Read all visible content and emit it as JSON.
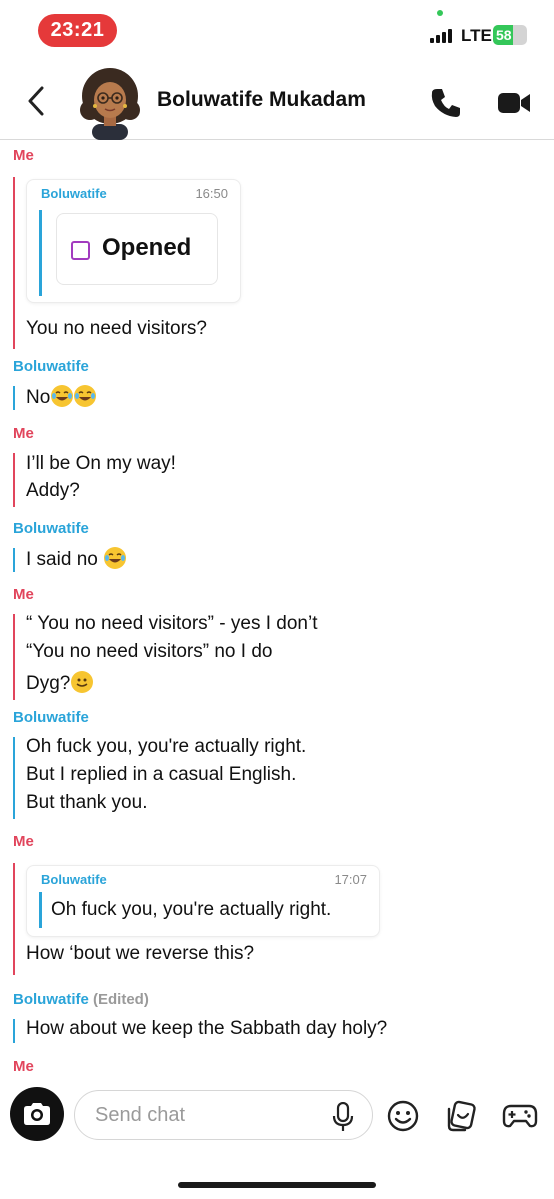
{
  "status_bar": {
    "time": "23:21",
    "network": "LTE",
    "battery": "58",
    "battery_level_percent": 58
  },
  "header": {
    "contact_name": "Boluwatife Mukadam",
    "icons": [
      "back-icon",
      "avatar",
      "phone-icon",
      "video-icon"
    ]
  },
  "chat": {
    "me_label": "Me",
    "bolu_label": "Boluwatife",
    "edited_label": "(Edited)",
    "quote1": {
      "sender": "Boluwatife",
      "time": "16:50",
      "status": "Opened"
    },
    "m1": "You no need visitors?",
    "m2": "No",
    "m3a": "I’ll be On my way!",
    "m3b": "Addy?",
    "m4": "I said no",
    "m5a": "“ You no need visitors” - yes I don’t",
    "m5b": "“You no need visitors” no I do",
    "m5c": "Dyg?",
    "m6a": "Oh fuck you, you're actually right.",
    "m6b": "But I replied in a casual English.",
    "m6c": "But thank you.",
    "quote2": {
      "sender": "Boluwatife",
      "time": "17:07",
      "text": "Oh fuck you, you're actually right."
    },
    "m7": "How ‘bout we reverse this?",
    "m8": "How about we keep the Sabbath day holy?"
  },
  "composer": {
    "placeholder": "Send chat",
    "icons": [
      "camera-icon",
      "microphone-icon",
      "smiley-icon",
      "sticker-icon",
      "game-controller-icon"
    ]
  },
  "colors": {
    "me": "#e1455c",
    "friend": "#2aa4d9",
    "time_pill": "#e5393a",
    "opened_square": "#a23bbf"
  }
}
